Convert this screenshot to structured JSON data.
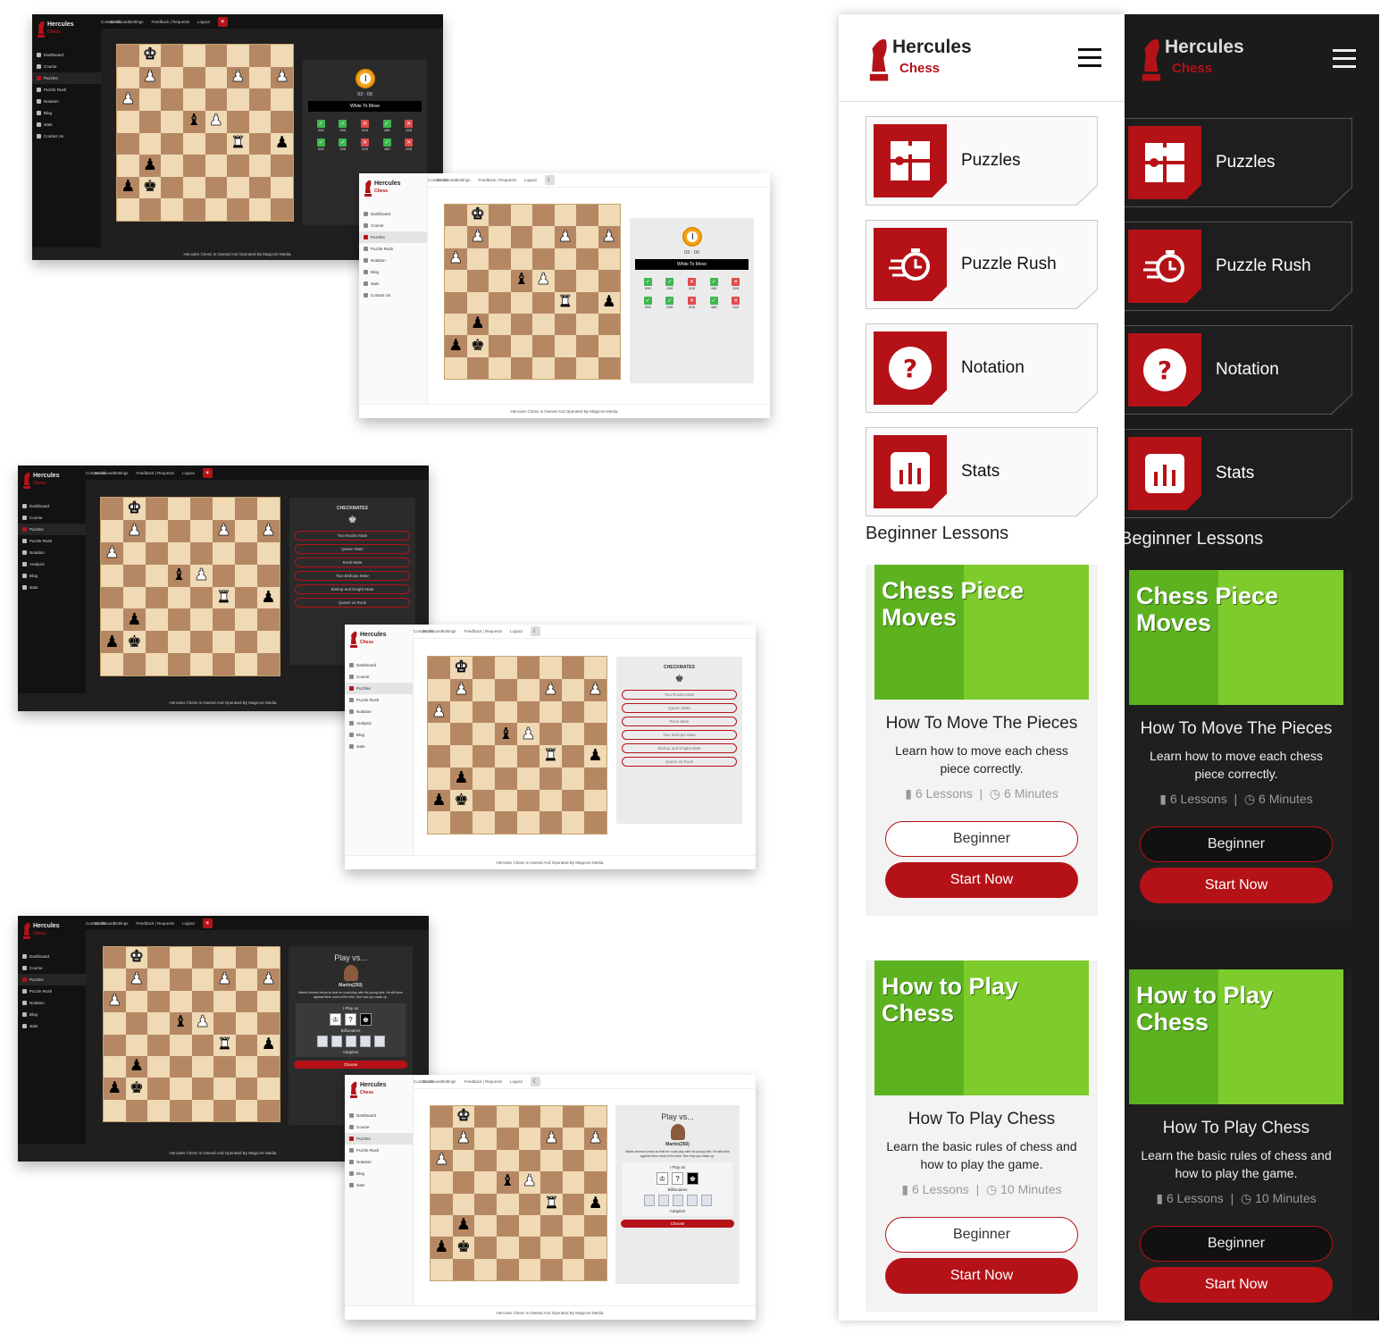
{
  "brand": {
    "name": "Hercules",
    "sub": "Chess"
  },
  "topbar": {
    "dashboard": "Dashboard",
    "contact": "Contact Us",
    "settings": "Settings",
    "feedback": "Feedback | Requests",
    "logout": "Logout"
  },
  "sidebar_a": [
    "Dashboard",
    "Course",
    "Puzzles",
    "Puzzle Rush",
    "Notation",
    "Blog",
    "stats",
    "Contact Us"
  ],
  "sidebar_b": [
    "Dashboard",
    "Course",
    "Puzzles",
    "Puzzle Rush",
    "Notation",
    "Analysis",
    "Blog",
    "stats"
  ],
  "sidebar_c": [
    "Dashboard",
    "Course",
    "Puzzles",
    "Puzzle Rush",
    "Notation",
    "Blog",
    "stats"
  ],
  "footer": "Hercules Chess Is Owned And Operated By Magcore Media.",
  "timer": {
    "time": "03 : 00",
    "to_move": "White To Move"
  },
  "results": [
    {
      "ok": true,
      "val": "598"
    },
    {
      "ok": true,
      "val": "698"
    },
    {
      "ok": false,
      "val": "608"
    },
    {
      "ok": true,
      "val": "488"
    },
    {
      "ok": false,
      "val": "828"
    },
    {
      "ok": true,
      "val": "598"
    },
    {
      "ok": true,
      "val": "698"
    },
    {
      "ok": false,
      "val": "608"
    },
    {
      "ok": true,
      "val": "488"
    },
    {
      "ok": false,
      "val": "828"
    }
  ],
  "checkmates": {
    "title": "CHECKMATES",
    "items": [
      "Two Rooks Mate",
      "Queen Mate",
      "Rook Mate",
      "Two Bishops Mate",
      "Bishop and Knight Mate",
      "Queen vs Rook"
    ]
  },
  "playvs": {
    "title": "Play vs...",
    "name": "Martin(250)",
    "desc": "Martin learned chess so that he could play with his young kids. He still wins against them most of the time. See how you stack up.",
    "iplay": "I Play as",
    "group": "Billionaires",
    "adaptive": "Adaptive",
    "choose": "Choose"
  },
  "mobile": {
    "cards": [
      "Puzzles",
      "Puzzle Rush",
      "Notation",
      "Stats"
    ],
    "section": "Beginner Lessons",
    "lessons": [
      {
        "banner": "Chess Piece Moves",
        "title": "How To Move The Pieces",
        "desc": "Learn how to move each chess piece correctly.",
        "lessons": "6 Lessons",
        "time": "6 Minutes",
        "level": "Beginner",
        "cta": "Start Now"
      },
      {
        "banner": "How to Play Chess",
        "title": "How To Play Chess",
        "desc": "Learn the basic rules of chess and how to play the game.",
        "lessons": "6 Lessons",
        "time": "10 Minutes",
        "level": "Beginner",
        "cta": "Start Now"
      }
    ]
  },
  "board": {
    "pieces": [
      {
        "sq": "b8",
        "p": "K",
        "c": "w"
      },
      {
        "sq": "b7",
        "p": "P",
        "c": "w"
      },
      {
        "sq": "f7",
        "p": "P",
        "c": "w"
      },
      {
        "sq": "h7",
        "p": "P",
        "c": "w"
      },
      {
        "sq": "a6",
        "p": "P",
        "c": "w"
      },
      {
        "sq": "d5",
        "p": "B",
        "c": "b"
      },
      {
        "sq": "e5",
        "p": "P",
        "c": "w"
      },
      {
        "sq": "f4",
        "p": "R",
        "c": "w"
      },
      {
        "sq": "h4",
        "p": "P",
        "c": "b"
      },
      {
        "sq": "b3",
        "p": "P",
        "c": "b"
      },
      {
        "sq": "a2",
        "p": "P",
        "c": "b"
      },
      {
        "sq": "b2",
        "p": "K",
        "c": "b"
      }
    ]
  },
  "colors": {
    "accent": "#b51218",
    "light_sq": "#f0d9b5",
    "dark_sq": "#b58863"
  }
}
